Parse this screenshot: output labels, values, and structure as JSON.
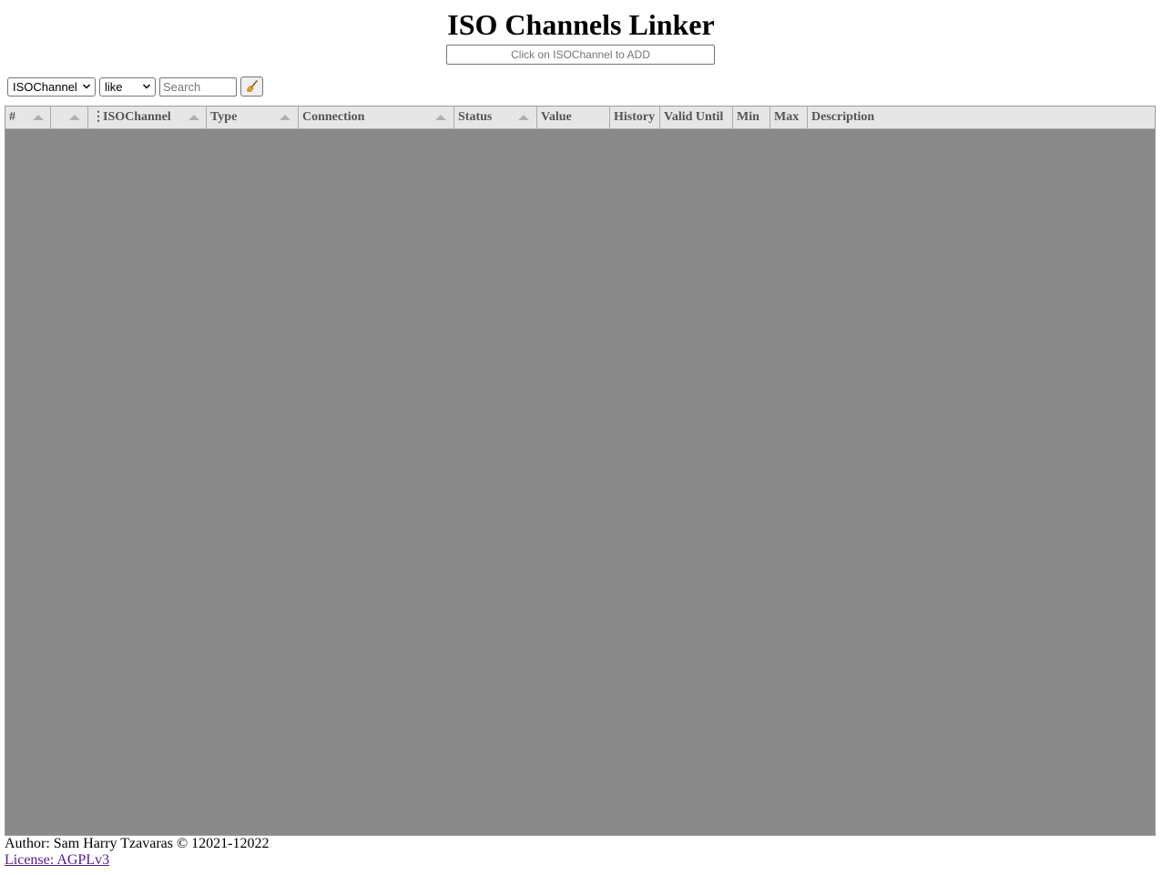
{
  "title": "ISO Channels Linker",
  "add_input": {
    "placeholder": "Click on ISOChannel to ADD"
  },
  "toolbar": {
    "field_select": "ISOChannel",
    "operator_select": "like",
    "search_placeholder": "Search",
    "clear_icon": "broom-icon"
  },
  "table": {
    "columns": [
      {
        "label": "#",
        "sortable": true
      },
      {
        "label": "",
        "sortable": true
      },
      {
        "label": "ISOChannel",
        "sortable": true,
        "menu_glyph": "⋮"
      },
      {
        "label": "Type",
        "sortable": true
      },
      {
        "label": "Connection",
        "sortable": true
      },
      {
        "label": "Status",
        "sortable": true
      },
      {
        "label": "Value",
        "sortable": false
      },
      {
        "label": "History",
        "sortable": false
      },
      {
        "label": "Valid Until",
        "sortable": false
      },
      {
        "label": "Min",
        "sortable": false
      },
      {
        "label": "Max",
        "sortable": false
      },
      {
        "label": "Description",
        "sortable": false
      }
    ],
    "rows": [],
    "body_color": "#8a8a8a",
    "header_color": "#e6e6e6"
  },
  "footer": {
    "author": "Author: Sam Harry Tzavaras © 12021-12022",
    "license_link": "License: AGPLv3"
  }
}
